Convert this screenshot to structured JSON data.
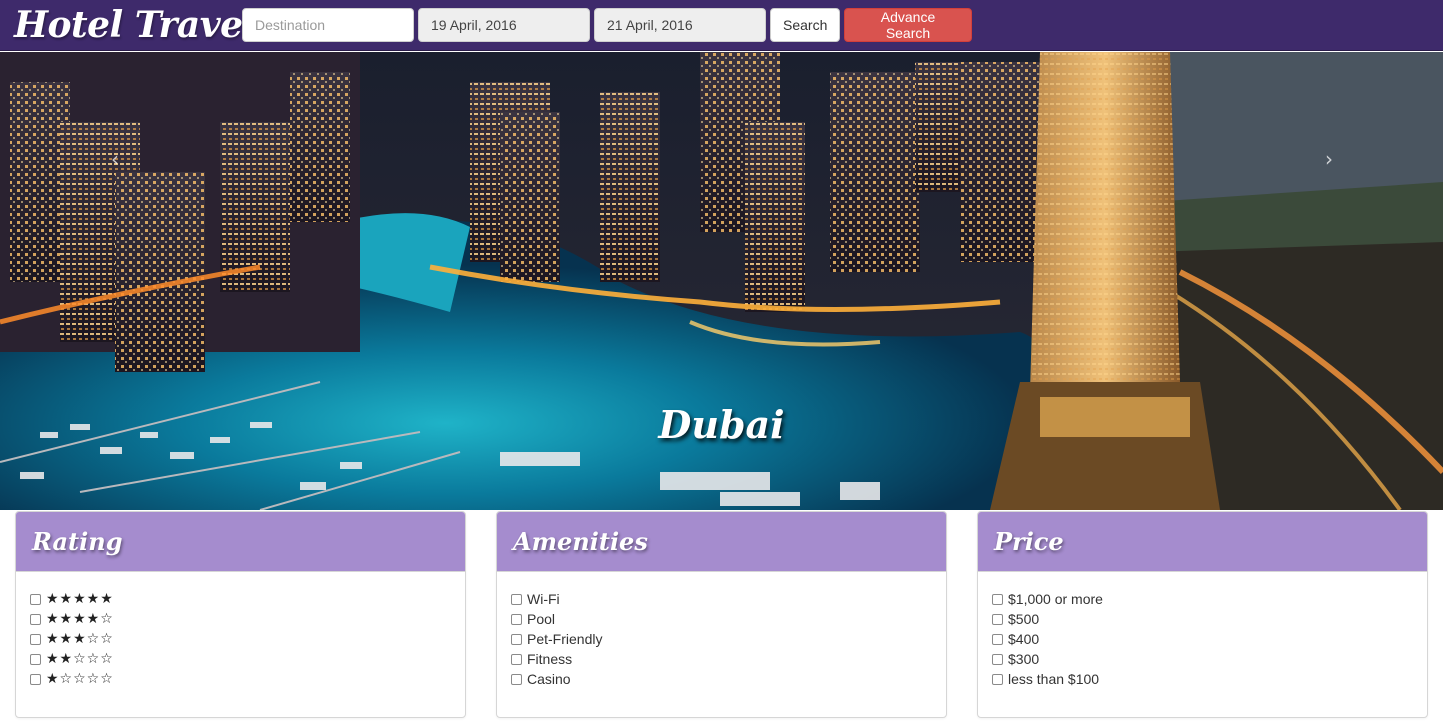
{
  "navbar": {
    "brand": "Hotel Travel",
    "destination_placeholder": "Destination",
    "checkin_date": "19 April, 2016",
    "checkout_date": "21 April, 2016",
    "search_label": "Search",
    "advance_search_label": "Advance Search",
    "background_color": "#3e2a6b",
    "advance_button_color": "#d9534f"
  },
  "hero": {
    "caption": "Dubai",
    "prev_icon": "chevron-left-icon",
    "next_icon": "chevron-right-icon"
  },
  "filters": {
    "header_color": "#a58cce",
    "rating": {
      "title": "Rating",
      "options": [
        "★★★★★",
        "★★★★☆",
        "★★★☆☆",
        "★★☆☆☆",
        "★☆☆☆☆"
      ]
    },
    "amenities": {
      "title": "Amenities",
      "options": [
        "Wi-Fi",
        "Pool",
        "Pet-Friendly",
        "Fitness",
        "Casino"
      ]
    },
    "price": {
      "title": "Price",
      "options": [
        "$1,000 or more",
        "$500",
        "$400",
        "$300",
        "less than $100"
      ]
    }
  }
}
